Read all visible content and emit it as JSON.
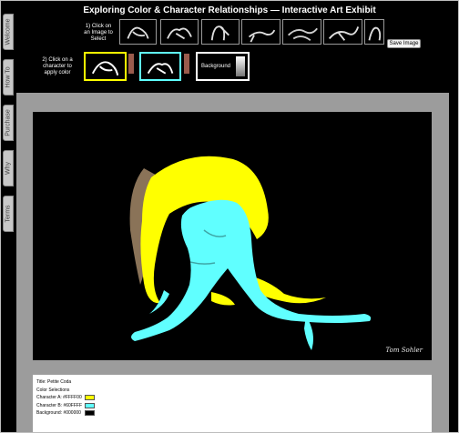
{
  "header": {
    "title": "Exploring Color & Character Relationships — Interactive Art Exhibit"
  },
  "sidebar": {
    "tabs": [
      {
        "label": "Welcome"
      },
      {
        "label": "How To"
      },
      {
        "label": "Purchase"
      },
      {
        "label": "Why"
      },
      {
        "label": "Terms"
      }
    ]
  },
  "step1": {
    "text": "1) Click on an Image to Select"
  },
  "step2": {
    "text": "2) Click on a character to apply color"
  },
  "thumbnails": [
    {
      "icon": "dancer-thumbnail"
    },
    {
      "icon": "dancer-thumbnail"
    },
    {
      "icon": "dancer-thumbnail"
    },
    {
      "icon": "dancer-thumbnail"
    },
    {
      "icon": "dancer-thumbnail"
    },
    {
      "icon": "dancer-thumbnail"
    },
    {
      "icon": "dancer-thumbnail"
    }
  ],
  "save_button": {
    "label": "Save Image"
  },
  "character_boxes": {
    "a": {
      "border_color": "#FFFF00"
    },
    "b": {
      "border_color": "#60FFFF"
    },
    "background_label": "Background"
  },
  "artwork": {
    "signature": "Tom Sohler",
    "character_a_color": "#FFFF00",
    "character_b_color": "#60FFFF",
    "background_color": "#000000"
  },
  "info": {
    "title": "Title: Petite Coda",
    "heading": "Color Selections",
    "character_a": "Character A: #FFFF00",
    "character_b": "Character B: #60FFFF",
    "background": "Background: #000000",
    "swatches": {
      "a": "#FFFF00",
      "b": "#60FFFF",
      "bg": "#000000"
    }
  }
}
